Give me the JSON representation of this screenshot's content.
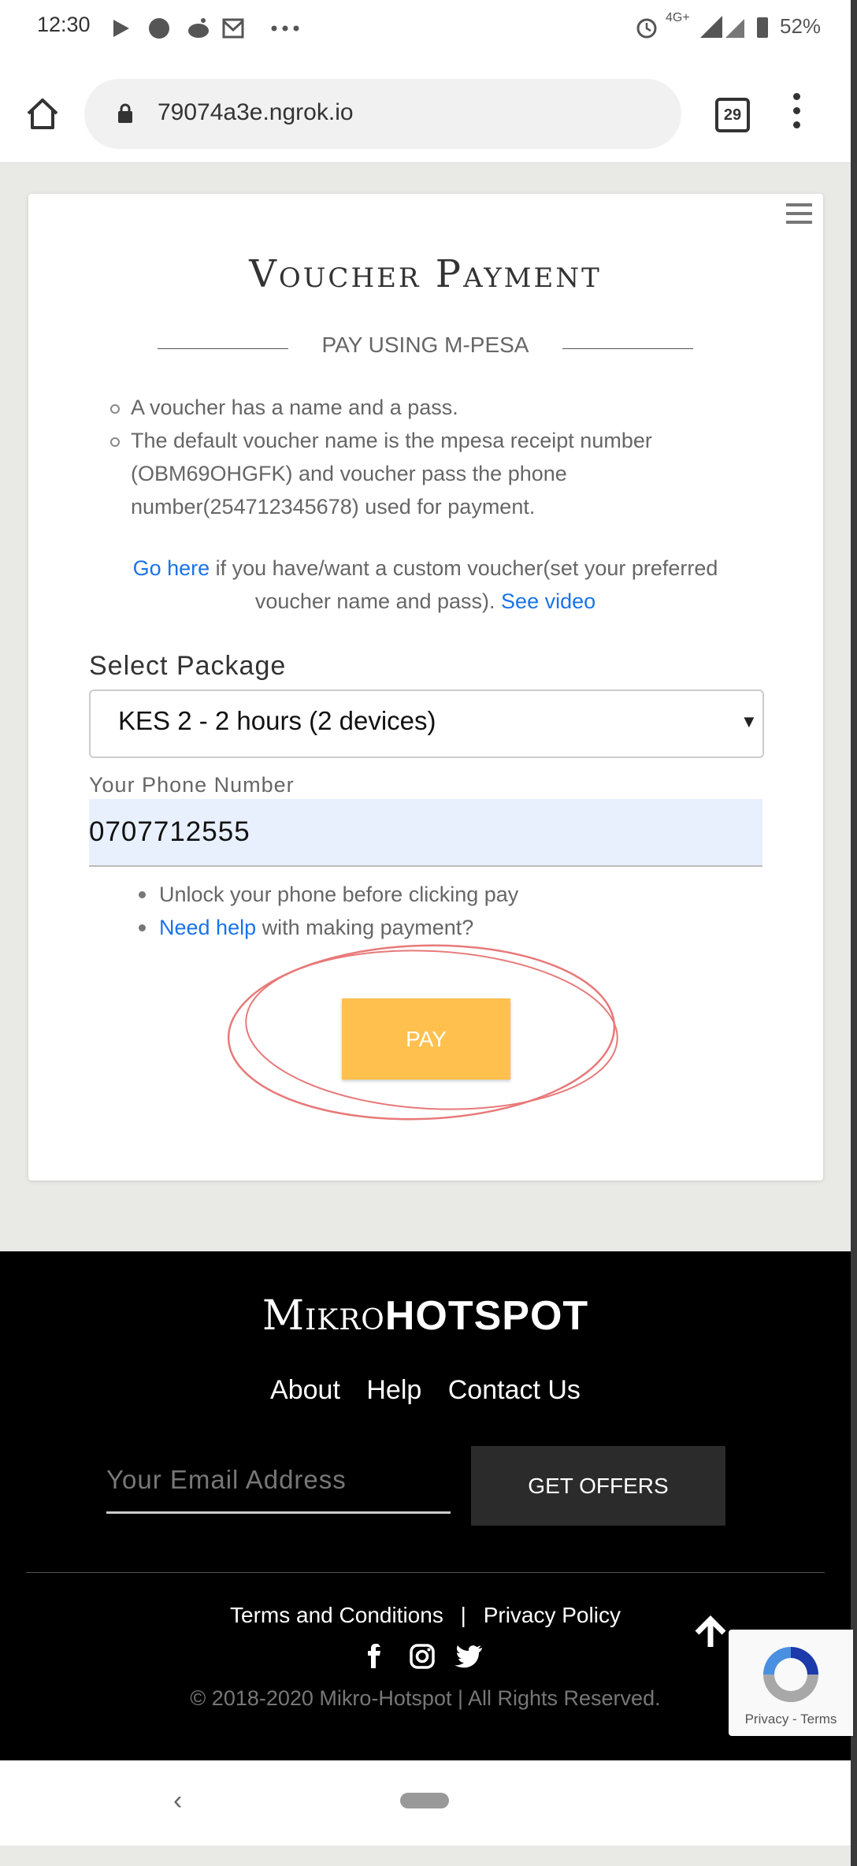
{
  "status_bar": {
    "time": "12:30",
    "network": "4G+",
    "battery_pct": "52%",
    "icons": [
      "play-store-icon",
      "circle-icon",
      "reddit-icon",
      "gmail-icon",
      "more-dots-icon",
      "alarm-icon",
      "signal-icon",
      "battery-icon"
    ]
  },
  "browser": {
    "url": "79074a3e.ngrok.io",
    "tab_count": "29"
  },
  "page": {
    "title": "Voucher Payment",
    "subtitle": "PAY USING M-PESA",
    "info_items": [
      "A voucher has a name and a pass.",
      "The default voucher name is the mpesa receipt number (OBM69OHGFK) and voucher pass the phone number(254712345678) used for payment."
    ],
    "custom": {
      "link1": "Go here",
      "text": " if you have/want a custom voucher(set your preferred voucher name and pass). ",
      "link2": "See video"
    },
    "package_label": "Select Package",
    "package_selected": "KES 2 - 2 hours (2 devices)",
    "phone_label": "Your Phone Number",
    "phone_value": "0707712555",
    "tips": {
      "tip1": "Unlock your phone before clicking pay",
      "tip2_link": "Need help",
      "tip2_text": " with making payment?"
    },
    "pay_label": "PAY"
  },
  "footer": {
    "brand_light": "Mikro",
    "brand_bold": "HOTSPOT",
    "nav": [
      "About",
      "Help",
      "Contact Us"
    ],
    "email_placeholder": "Your Email Address",
    "offers_label": "GET OFFERS",
    "terms": "Terms and Conditions",
    "separator": "|",
    "privacy": "Privacy Policy",
    "socials": [
      "facebook-icon",
      "instagram-icon",
      "twitter-icon"
    ],
    "copyright": "© 2018-2020 Mikro-Hotspot | All Rights Reserved.",
    "recaptcha": "Privacy - Terms"
  },
  "colors": {
    "accent_link": "#1a73e8",
    "pay_button": "#ffc04d",
    "annotation_ring": "#e87979"
  }
}
